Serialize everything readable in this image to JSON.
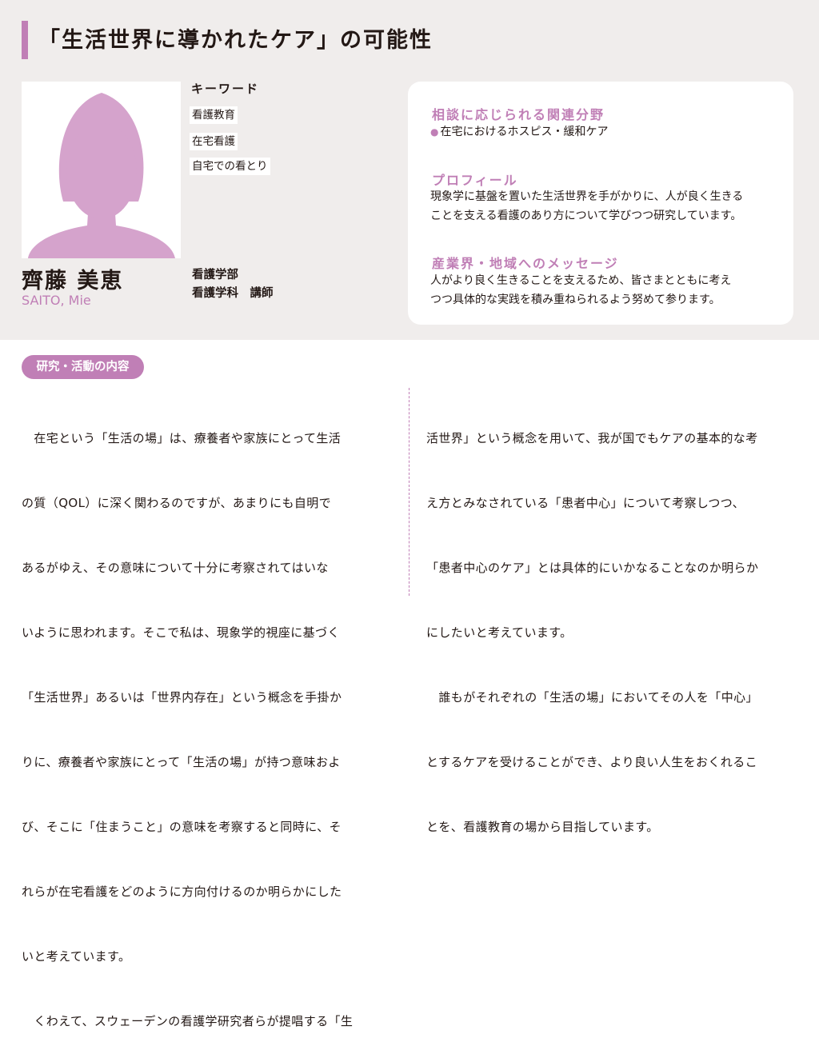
{
  "title": "「生活世界に導かれたケア」の可能性",
  "colors": {
    "accent": "#c07fb6",
    "top_bg": "#f0edec",
    "text": "#231815"
  },
  "photo_icon": "person-silhouette-icon",
  "keywords": {
    "heading": "キーワード",
    "items": [
      "看護教育",
      "在宅看護",
      "自宅での看とり"
    ]
  },
  "person": {
    "name": "齊藤 美恵",
    "name_roman": "SAITO, Mie",
    "faculty": "看護学部",
    "department": "看護学科　講師"
  },
  "card": {
    "fields_heading": "相談に応じられる関連分野",
    "fields_item": "在宅におけるホスピス・緩和ケア",
    "profile_heading": "プロフィール",
    "profile_lines": [
      "現象学に基盤を置いた生活世界を手がかりに、人が良く生きる",
      "ことを支える看護のあり方について学びつつ研究しています。"
    ],
    "message_heading": "産業界・地域へのメッセージ",
    "message_lines": [
      "人がより良く生きることを支えるため、皆さまとともに考え",
      "つつ具体的な実践を積み重ねられるよう努めて参ります。"
    ]
  },
  "research": {
    "badge": "研究・活動の内容",
    "left_lines": [
      "　在宅という「生活の場」は、療養者や家族にとって生活",
      "の質（QOL）に深く関わるのですが、あまりにも自明で",
      "あるがゆえ、その意味について十分に考察されてはいな",
      "いように思われます。そこで私は、現象学的視座に基づく",
      "「生活世界」あるいは「世界内存在」という概念を手掛か",
      "りに、療養者や家族にとって「生活の場」が持つ意味およ",
      "び、そこに「住まうこと」の意味を考察すると同時に、そ",
      "れらが在宅看護をどのように方向付けるのか明らかにした",
      "いと考えています。",
      "　くわえて、スウェーデンの看護学研究者らが提唱する「生"
    ],
    "right_lines": [
      "活世界」という概念を用いて、我が国でもケアの基本的な考",
      "え方とみなされている「患者中心」について考察しつつ、",
      "「患者中心のケア」とは具体的にいかなることなのか明らか",
      "にしたいと考えています。",
      "　誰もがそれぞれの「生活の場」においてその人を「中心」",
      "とするケアを受けることができ、より良い人生をおくれるこ",
      "とを、看護教育の場から目指しています。"
    ]
  }
}
